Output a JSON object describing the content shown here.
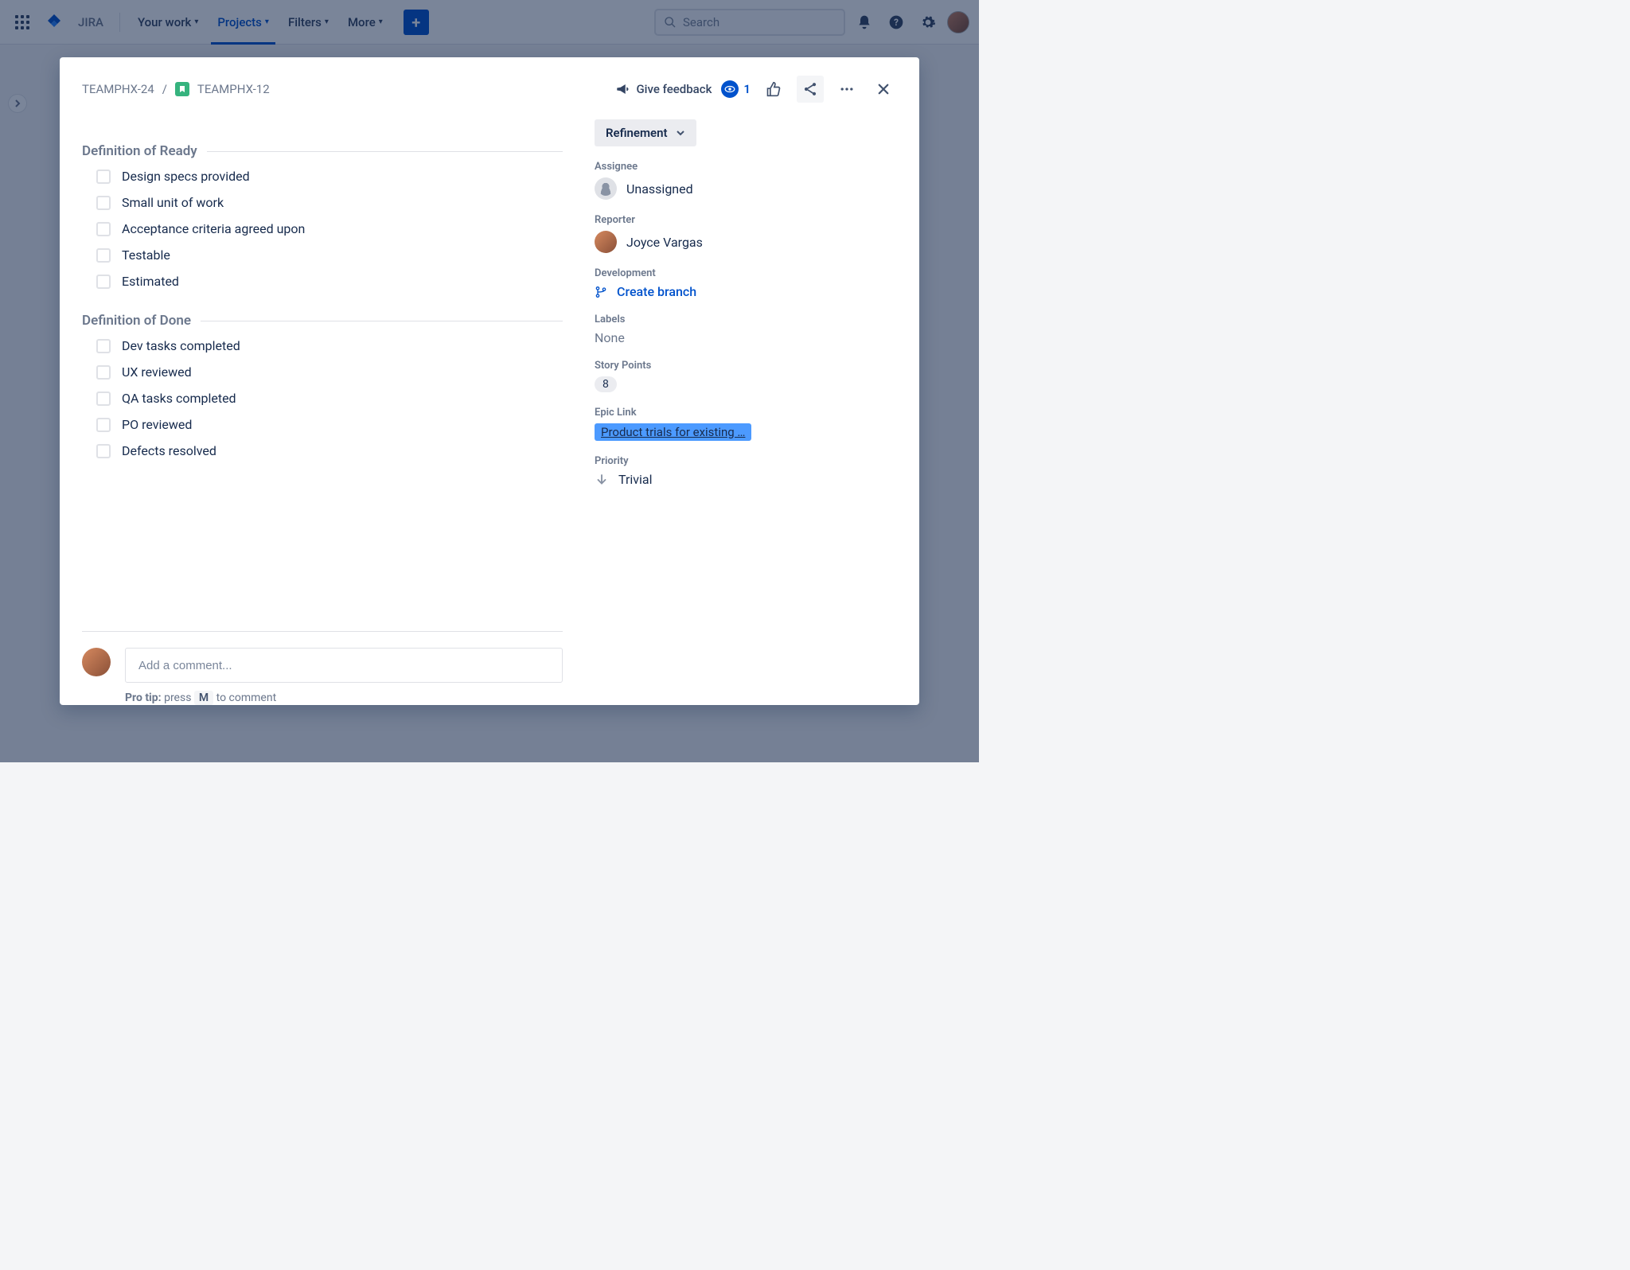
{
  "nav": {
    "product": "JIRA",
    "items": [
      "Your work",
      "Projects",
      "Filters",
      "More"
    ],
    "active_index": 1,
    "search_placeholder": "Search"
  },
  "dialog": {
    "breadcrumb": {
      "parent": "TEAMPHX-24",
      "current": "TEAMPHX-12"
    },
    "feedback_label": "Give feedback",
    "watch_count": "1",
    "sections": {
      "ready": {
        "title": "Definition of Ready",
        "items": [
          "Design specs provided",
          "Small unit of work",
          "Acceptance criteria agreed upon",
          "Testable",
          "Estimated"
        ]
      },
      "done": {
        "title": "Definition of Done",
        "items": [
          "Dev tasks completed",
          "UX reviewed",
          "QA tasks completed",
          "PO reviewed",
          "Defects resolved"
        ]
      }
    },
    "comment": {
      "placeholder": "Add a comment...",
      "protip_prefix": "Pro tip:",
      "protip_press": "press",
      "protip_key": "M",
      "protip_suffix": "to comment"
    },
    "sidebar": {
      "status": "Refinement",
      "assignee": {
        "label": "Assignee",
        "value": "Unassigned"
      },
      "reporter": {
        "label": "Reporter",
        "value": "Joyce Vargas"
      },
      "development": {
        "label": "Development",
        "action": "Create branch"
      },
      "labels": {
        "label": "Labels",
        "value": "None"
      },
      "story_points": {
        "label": "Story Points",
        "value": "8"
      },
      "epic": {
        "label": "Epic Link",
        "value": "Product trials for existing …"
      },
      "priority": {
        "label": "Priority",
        "value": "Trivial"
      }
    }
  }
}
